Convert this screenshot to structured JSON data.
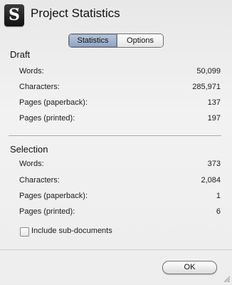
{
  "window": {
    "title": "Project Statistics",
    "app_icon_glyph_main": "S",
    "app_icon_glyph_quote": "“"
  },
  "tabs": {
    "statistics": "Statistics",
    "options": "Options",
    "selected": "Statistics"
  },
  "draft": {
    "heading": "Draft",
    "rows": [
      {
        "label": "Words:",
        "value": "50,099"
      },
      {
        "label": "Characters:",
        "value": "285,971"
      },
      {
        "label": "Pages (paperback):",
        "value": "137"
      },
      {
        "label": "Pages (printed):",
        "value": "197"
      }
    ]
  },
  "selection": {
    "heading": "Selection",
    "rows": [
      {
        "label": "Words:",
        "value": "373"
      },
      {
        "label": "Characters:",
        "value": "2,084"
      },
      {
        "label": "Pages (paperback):",
        "value": "1"
      },
      {
        "label": "Pages (printed):",
        "value": "6"
      }
    ]
  },
  "options": {
    "include_subdocs_label": "Include sub-documents",
    "include_subdocs_checked": false
  },
  "footer": {
    "ok_label": "OK"
  },
  "icons": {
    "app": "scrivener-app-icon",
    "resize": "resize-grip-icon"
  }
}
